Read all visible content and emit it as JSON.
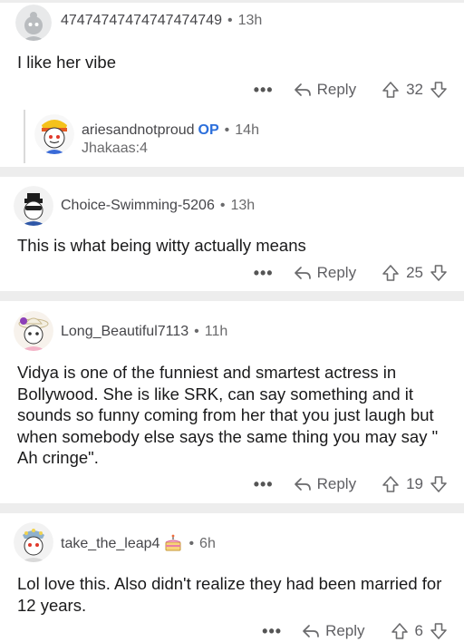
{
  "comments": [
    {
      "username": "47474747474747474749",
      "time": "13h",
      "text": "I like her vibe",
      "reply_label": "Reply",
      "score": "32",
      "more": "•••",
      "reply": {
        "username": "ariesandnotproud",
        "op_badge": "OP",
        "time": "14h",
        "flair": "Jhakaas:4"
      }
    },
    {
      "username": "Choice-Swimming-5206",
      "time": "13h",
      "text": "This is what being witty actually means",
      "reply_label": "Reply",
      "score": "25",
      "more": "•••"
    },
    {
      "username": "Long_Beautiful7113",
      "time": "11h",
      "text": "Vidya is one of the funniest and smartest actress in Bollywood. She is like SRK, can say something and it sounds so funny coming from her that you just laugh but when somebody else says the same thing you may say \" Ah cringe\".",
      "reply_label": "Reply",
      "score": "19",
      "more": "•••"
    },
    {
      "username": "take_the_leap4",
      "time": "6h",
      "text": "Lol love this. Also didn't realize they had been married for 12 years.",
      "reply_label": "Reply",
      "score": "6",
      "more": "•••",
      "flair_icon": "cake-icon"
    }
  ],
  "separator": "•",
  "colors": {
    "op": "#2c6fdb",
    "divider": "#ededed",
    "meta": "#6a6a6c",
    "thread": "#dadada"
  }
}
